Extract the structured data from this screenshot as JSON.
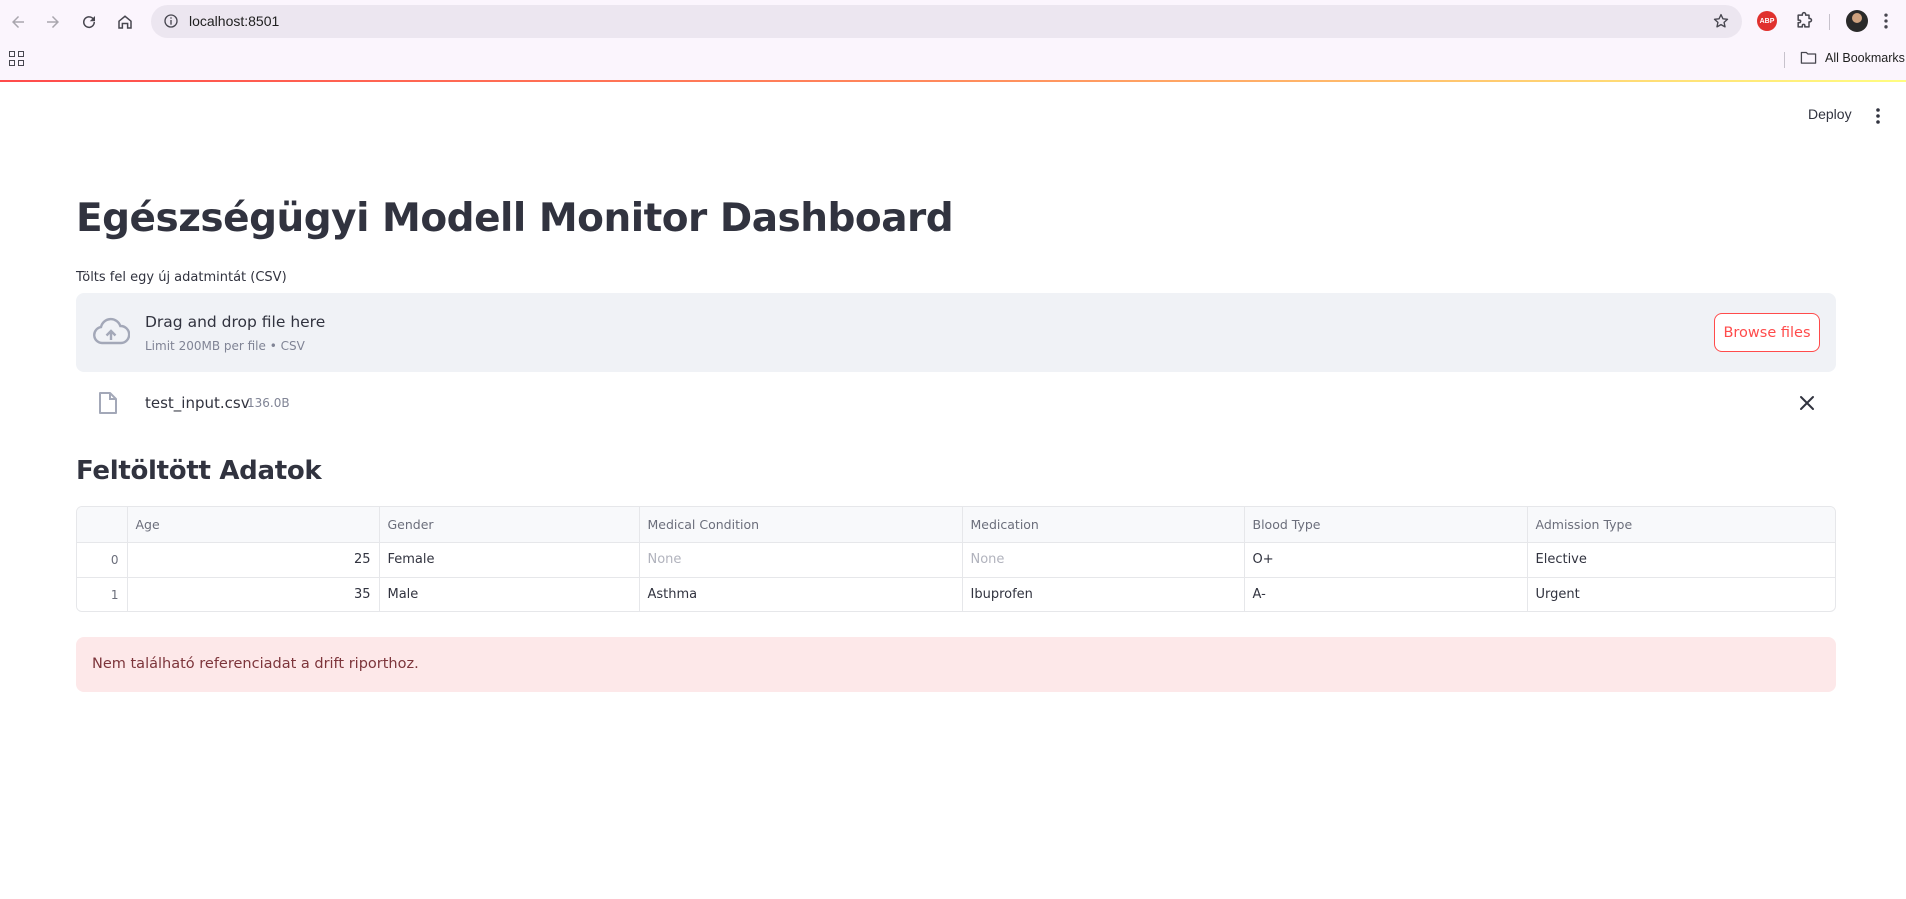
{
  "browser": {
    "url": "localhost:8501",
    "bookmarks_label": "All Bookmarks",
    "extension_abp": "ABP"
  },
  "app": {
    "deploy_label": "Deploy",
    "title": "Egészségügyi Modell Monitor Dashboard",
    "uploader": {
      "label": "Tölts fel egy új adatmintát (CSV)",
      "drop_text": "Drag and drop file here",
      "limit_text": "Limit 200MB per file • CSV",
      "browse_label": "Browse files"
    },
    "file": {
      "name": "test_input.csv",
      "size": "136.0B"
    },
    "section_title": "Feltöltött Adatok",
    "table": {
      "columns": [
        "",
        "Age",
        "Gender",
        "Medical Condition",
        "Medication",
        "Blood Type",
        "Admission Type"
      ],
      "rows": [
        [
          "0",
          "25",
          "Female",
          "None",
          "None",
          "O+",
          "Elective"
        ],
        [
          "1",
          "35",
          "Male",
          "Asthma",
          "Ibuprofen",
          "A-",
          "Urgent"
        ]
      ]
    },
    "error_message": "Nem található referenciadat a drift riporthoz."
  },
  "colors": {
    "accent": "#ff4b4b",
    "dropzone_bg": "#f0f2f6",
    "error_bg": "#fde8e9",
    "error_text": "#7d353b",
    "chrome_bg": "#fbf5fd"
  }
}
